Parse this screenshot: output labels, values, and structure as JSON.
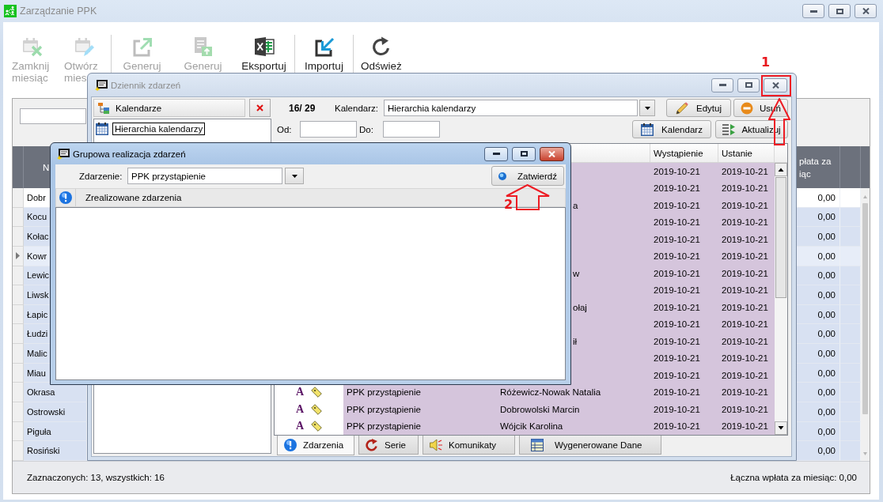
{
  "app_window": {
    "title": "Zarządzanie PPK",
    "active": false
  },
  "toolbar": {
    "groups": [
      {
        "buttons": [
          {
            "label": "Zamknij miesiąc",
            "disabled": true
          },
          {
            "label": "Otwórz mies",
            "disabled": true
          }
        ]
      },
      {
        "buttons": [
          {
            "label": "Generuj",
            "disabled": true
          },
          {
            "label": "Generuj",
            "disabled": true
          },
          {
            "label": "Eksportuj",
            "disabled": false
          }
        ]
      },
      {
        "buttons": [
          {
            "label": "Importuj",
            "disabled": false
          }
        ]
      },
      {
        "buttons": [
          {
            "label": "Odśwież",
            "disabled": false
          }
        ]
      }
    ]
  },
  "grid": {
    "columns": [
      {
        "heading": "N"
      },
      {
        "heading": "płata za iąc"
      }
    ],
    "rows": [
      {
        "name": "Dobr",
        "amount": "0,00",
        "selected": false,
        "current": false
      },
      {
        "name": "Kocu",
        "amount": "0,00",
        "selected": true,
        "current": false
      },
      {
        "name": "Kołac",
        "amount": "0,00",
        "selected": true,
        "current": false
      },
      {
        "name": "Kowr",
        "amount": "0,00",
        "selected": true,
        "current": true
      },
      {
        "name": "Lewic",
        "amount": "0,00",
        "selected": true,
        "current": false
      },
      {
        "name": "Liwsk",
        "amount": "0,00",
        "selected": true,
        "current": false
      },
      {
        "name": "Łapic",
        "amount": "0,00",
        "selected": true,
        "current": false
      },
      {
        "name": "Łudzi",
        "amount": "0,00",
        "selected": true,
        "current": false
      },
      {
        "name": "Malic",
        "amount": "0,00",
        "selected": true,
        "current": false
      },
      {
        "name": "Miau",
        "amount": "0,00",
        "selected": true,
        "current": false
      },
      {
        "name": "Okrasa",
        "amount": "0,00",
        "selected": true,
        "current": false
      },
      {
        "name": "Ostrowski",
        "amount": "0,00",
        "selected": true,
        "current": false
      },
      {
        "name": "Piguła",
        "amount": "0,00",
        "selected": true,
        "current": false
      },
      {
        "name": "Rosiński",
        "amount": "0,00",
        "selected": true,
        "current": false
      }
    ]
  },
  "status_bar": {
    "selection": "Zaznaczonych: 13, wszystkich: 16",
    "total": "Łączna wpłata za miesiąc: 0,00"
  },
  "event_log_window": {
    "title": "Dziennik zdarzeń",
    "active": false,
    "calendars_panel": {
      "title": "Kalendarze",
      "items": [
        {
          "label": "Hierarchia kalendarzy",
          "editing": true
        }
      ]
    },
    "record_count": "16/ 29",
    "calendar_field": {
      "label": "Kalendarz:",
      "value": "Hierarchia kalendarzy"
    },
    "actions": [
      {
        "label": "Edytuj"
      },
      {
        "label": "Usuń"
      }
    ],
    "date_from": {
      "label": "Od:"
    },
    "date_to": {
      "label": "Do:"
    },
    "filter_buttons": [
      {
        "label": "Kalendarz"
      },
      {
        "label": "Aktualizuj"
      }
    ],
    "events": {
      "columns": [
        {
          "heading": "Wystąpienie"
        },
        {
          "heading": "Ustanie"
        }
      ],
      "rows": [
        {
          "occurrence": "2019-10-21",
          "end": "2019-10-21"
        },
        {
          "occurrence": "2019-10-21",
          "end": "2019-10-21"
        },
        {
          "person": "a",
          "occurrence": "2019-10-21",
          "end": "2019-10-21"
        },
        {
          "occurrence": "2019-10-21",
          "end": "2019-10-21"
        },
        {
          "occurrence": "2019-10-21",
          "end": "2019-10-21"
        },
        {
          "occurrence": "2019-10-21",
          "end": "2019-10-21"
        },
        {
          "person": "w",
          "occurrence": "2019-10-21",
          "end": "2019-10-21"
        },
        {
          "occurrence": "2019-10-21",
          "end": "2019-10-21"
        },
        {
          "person": "ołaj",
          "occurrence": "2019-10-21",
          "end": "2019-10-21"
        },
        {
          "occurrence": "2019-10-21",
          "end": "2019-10-21"
        },
        {
          "person": "ił",
          "occurrence": "2019-10-21",
          "end": "2019-10-21"
        },
        {
          "occurrence": "2019-10-21",
          "end": "2019-10-21"
        },
        {
          "occurrence": "2019-10-21",
          "end": "2019-10-21"
        },
        {
          "marker": "A",
          "event": "PPK przystąpienie",
          "person": "Różewicz-Nowak Natalia",
          "occurrence": "2019-10-21",
          "end": "2019-10-21"
        },
        {
          "marker": "A",
          "event": "PPK przystąpienie",
          "person": "Dobrowolski Marcin",
          "occurrence": "2019-10-21",
          "end": "2019-10-21"
        },
        {
          "marker": "A",
          "event": "PPK przystąpienie",
          "person": "Wójcik Karolina",
          "occurrence": "2019-10-21",
          "end": "2019-10-21"
        }
      ]
    },
    "tabs": [
      {
        "label": "Zdarzenia",
        "selected": true
      },
      {
        "label": "Serie",
        "selected": false
      },
      {
        "label": "Komunikaty",
        "selected": false
      },
      {
        "label": "Wygenerowane Dane",
        "selected": false
      }
    ]
  },
  "group_dialog": {
    "title": "Grupowa realizacja zdarzeń",
    "active": true,
    "event_field": {
      "label": "Zdarzenie:",
      "value": "PPK przystąpienie"
    },
    "confirm_button": {
      "label": "Zatwierdź"
    },
    "results": {
      "title": "Zrealizowane zdarzenia"
    }
  },
  "annotations": [
    {
      "number": "1",
      "frame": true
    },
    {
      "number": "2",
      "frame": false
    }
  ]
}
